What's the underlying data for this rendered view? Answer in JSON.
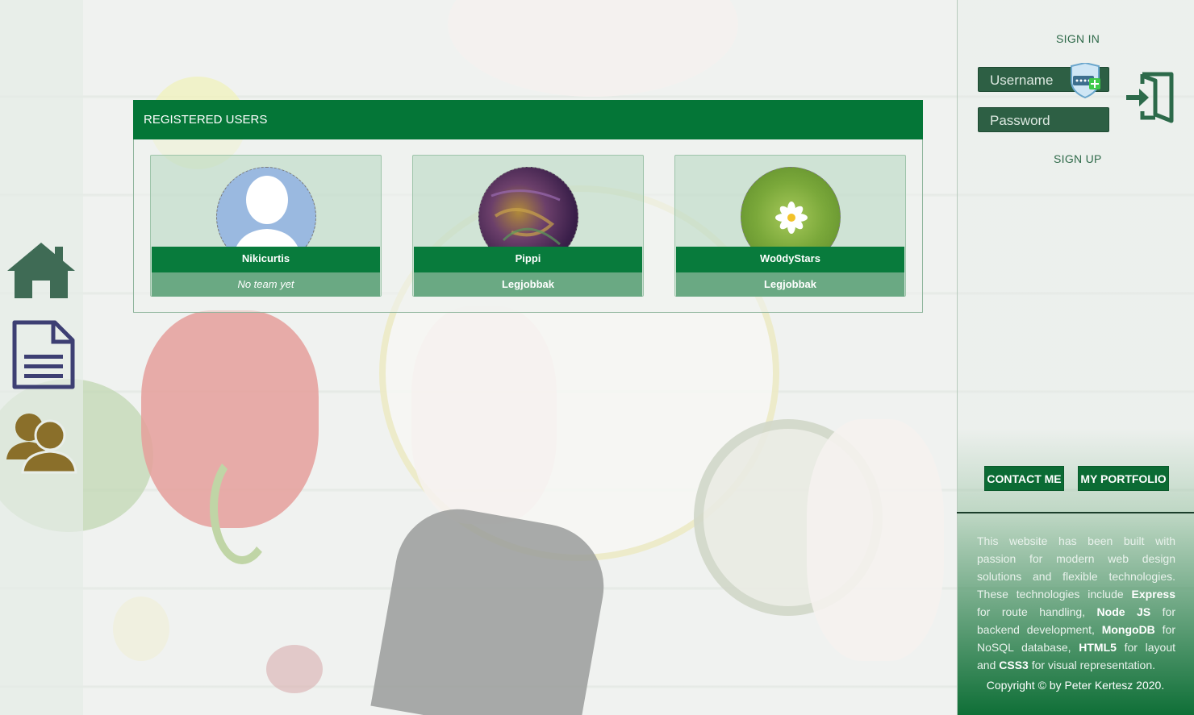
{
  "nav": {
    "items": [
      {
        "icon": "home-icon",
        "color": "#3f6b55"
      },
      {
        "icon": "document-icon",
        "color": "#3d3f73"
      },
      {
        "icon": "users-icon",
        "color": "#8a6f2a"
      }
    ]
  },
  "registered_users": {
    "title": "REGISTERED USERS",
    "users": [
      {
        "name": "Nikicurtis",
        "team": "No team yet",
        "avatar": "default-user-avatar"
      },
      {
        "name": "Pippi",
        "team": "Legjobbak",
        "avatar": "abstract-photo-avatar"
      },
      {
        "name": "Wo0dyStars",
        "team": "Legjobbak",
        "avatar": "daisy-photo-avatar"
      }
    ]
  },
  "auth": {
    "sign_in_label": "SIGN IN",
    "username_placeholder": "Username",
    "password_placeholder": "Password",
    "sign_up_label": "SIGN UP"
  },
  "footer": {
    "contact_label": "CONTACT ME",
    "portfolio_label": "MY PORTFOLIO",
    "about_parts": {
      "p1": "This website has been built with passion for modern web design solutions and flexible technologies. These technologies include ",
      "express": "Express",
      "p2": " for route handling, ",
      "node": "Node JS",
      "p3": " for backend development, ",
      "mongo": "MongoDB",
      "p4": " for NoSQL database, ",
      "html5": "HTML5",
      "p5": " for layout and ",
      "css3": "CSS3",
      "p6": " for visual representation."
    },
    "copyright": "Copyright © by Peter Kertesz 2020."
  },
  "colors": {
    "brand_green": "#047637",
    "team_green": "#6aa983",
    "field_green": "#2d5f44"
  }
}
